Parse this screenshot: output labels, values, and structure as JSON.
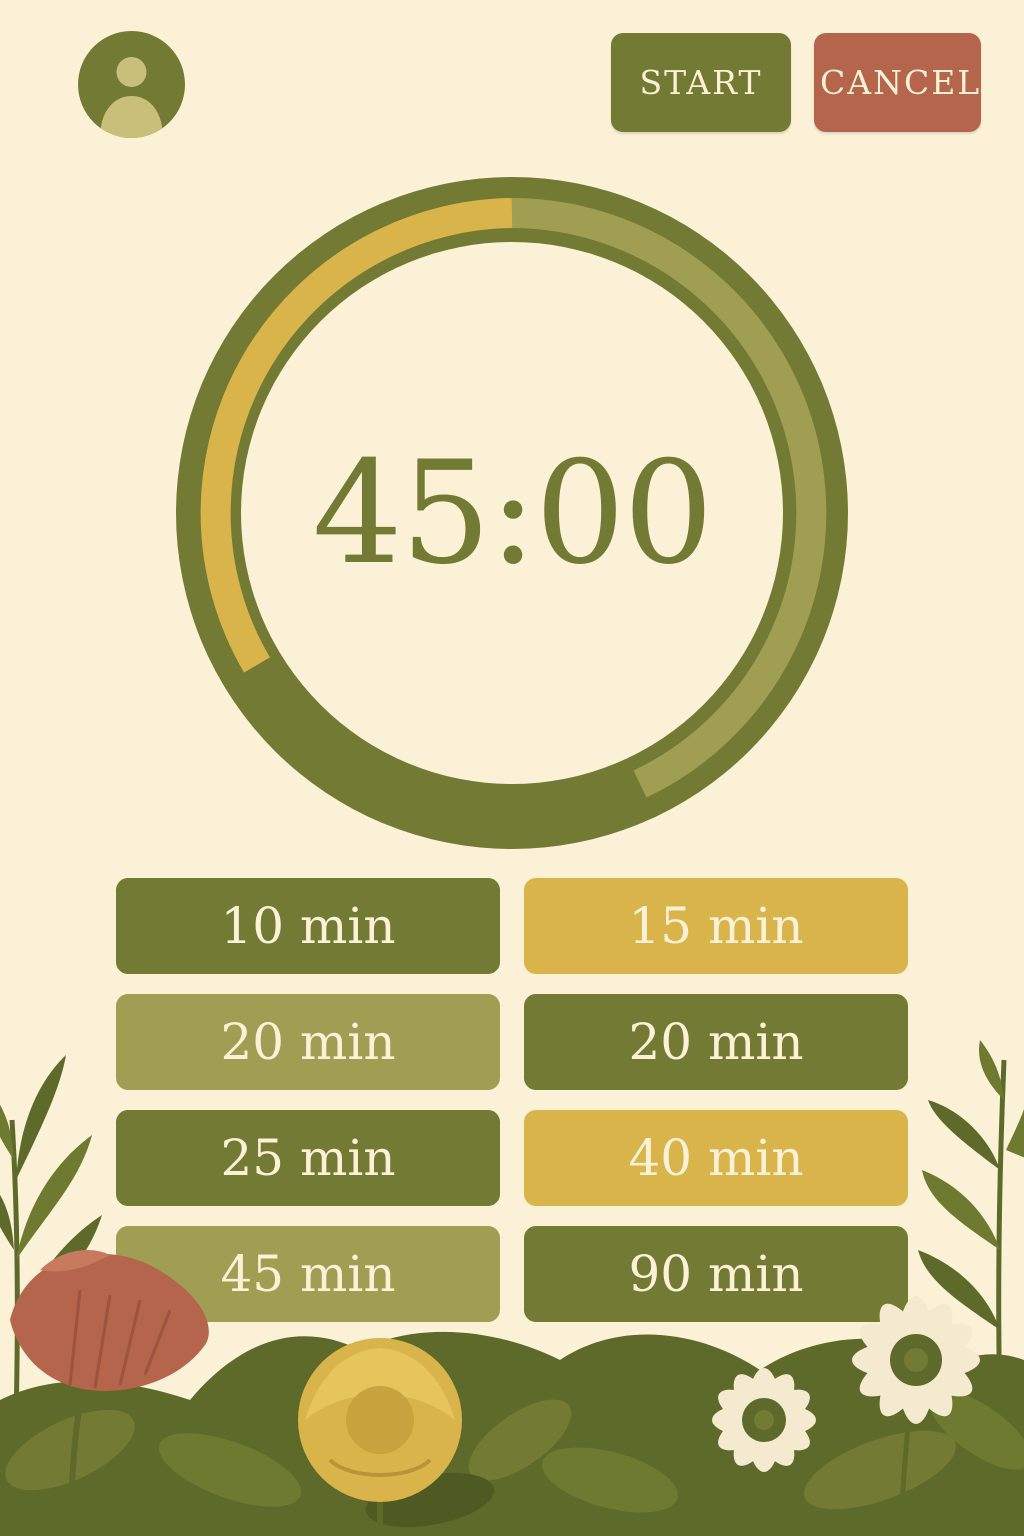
{
  "header": {
    "avatar_icon": "user-icon",
    "start_label": "START",
    "cancel_label": "CANCEL"
  },
  "timer": {
    "display": "45:00",
    "progress_fraction": 0.33
  },
  "presets": [
    {
      "label": "10 min"
    },
    {
      "label": "15 min"
    },
    {
      "label": "20 min"
    },
    {
      "label": "20 min"
    },
    {
      "label": "25 min"
    },
    {
      "label": "40 min"
    },
    {
      "label": "45 min"
    },
    {
      "label": "90 min"
    }
  ],
  "colors": {
    "background": "#fbf1d7",
    "olive_dark": "#737a33",
    "olive_light": "#a09e53",
    "gold": "#d8b44a",
    "terracotta": "#b5654c"
  }
}
